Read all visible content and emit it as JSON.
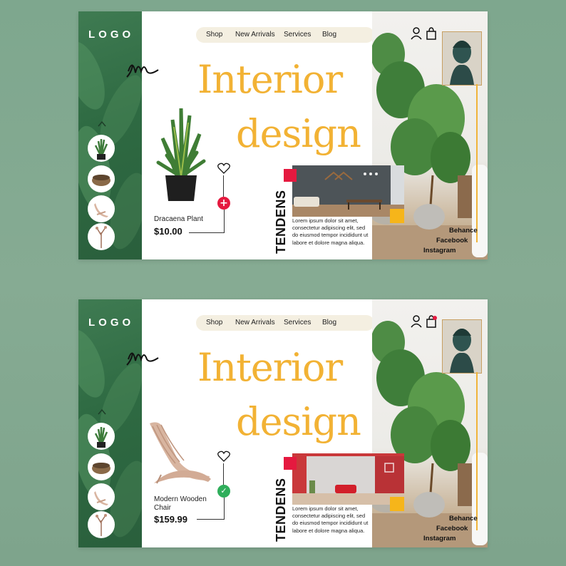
{
  "mockups": [
    {
      "logo": "LOGO",
      "nav": [
        "Shop",
        "New Arrivals",
        "Services",
        "Blog"
      ],
      "title_line1": "Interior",
      "title_line2": "design",
      "product": {
        "name": "Dracaena Plant",
        "price": "$10.00",
        "action": "add"
      },
      "tendens": "TENDENS",
      "lorem": "Lorem ipsum dolor sit amet, consectetur adipiscing elit, sed do eiusmod tempor incididunt ut labore et dolore magna aliqua.",
      "social": [
        "Behance",
        "Facebook",
        "Instagram"
      ],
      "cart_has_item": false
    },
    {
      "logo": "LOGO",
      "nav": [
        "Shop",
        "New Arrivals",
        "Services",
        "Blog"
      ],
      "title_line1": "Interior",
      "title_line2": "design",
      "product": {
        "name_line1": "Modern Wooden",
        "name_line2": "Chair",
        "price": "$159.99",
        "action": "added"
      },
      "tendens": "TENDENS",
      "lorem": "Lorem ipsum dolor sit amet, consectetur adipiscing elit, sed do eiusmod tempor incididunt ut labore et dolore magna aliqua.",
      "social": [
        "Behance",
        "Facebook",
        "Instagram"
      ],
      "cart_has_item": true
    }
  ],
  "colors": {
    "accent_gold": "#f2b234",
    "panel_green": "#2e6a42",
    "background": "#7ea78e",
    "red": "#e5193f",
    "yellow": "#f6b51a",
    "added_green": "#2fae5b"
  },
  "icons": [
    "user-icon",
    "shopping-bag-icon",
    "heart-icon",
    "plus-icon",
    "check-icon",
    "chevron-up-icon"
  ]
}
